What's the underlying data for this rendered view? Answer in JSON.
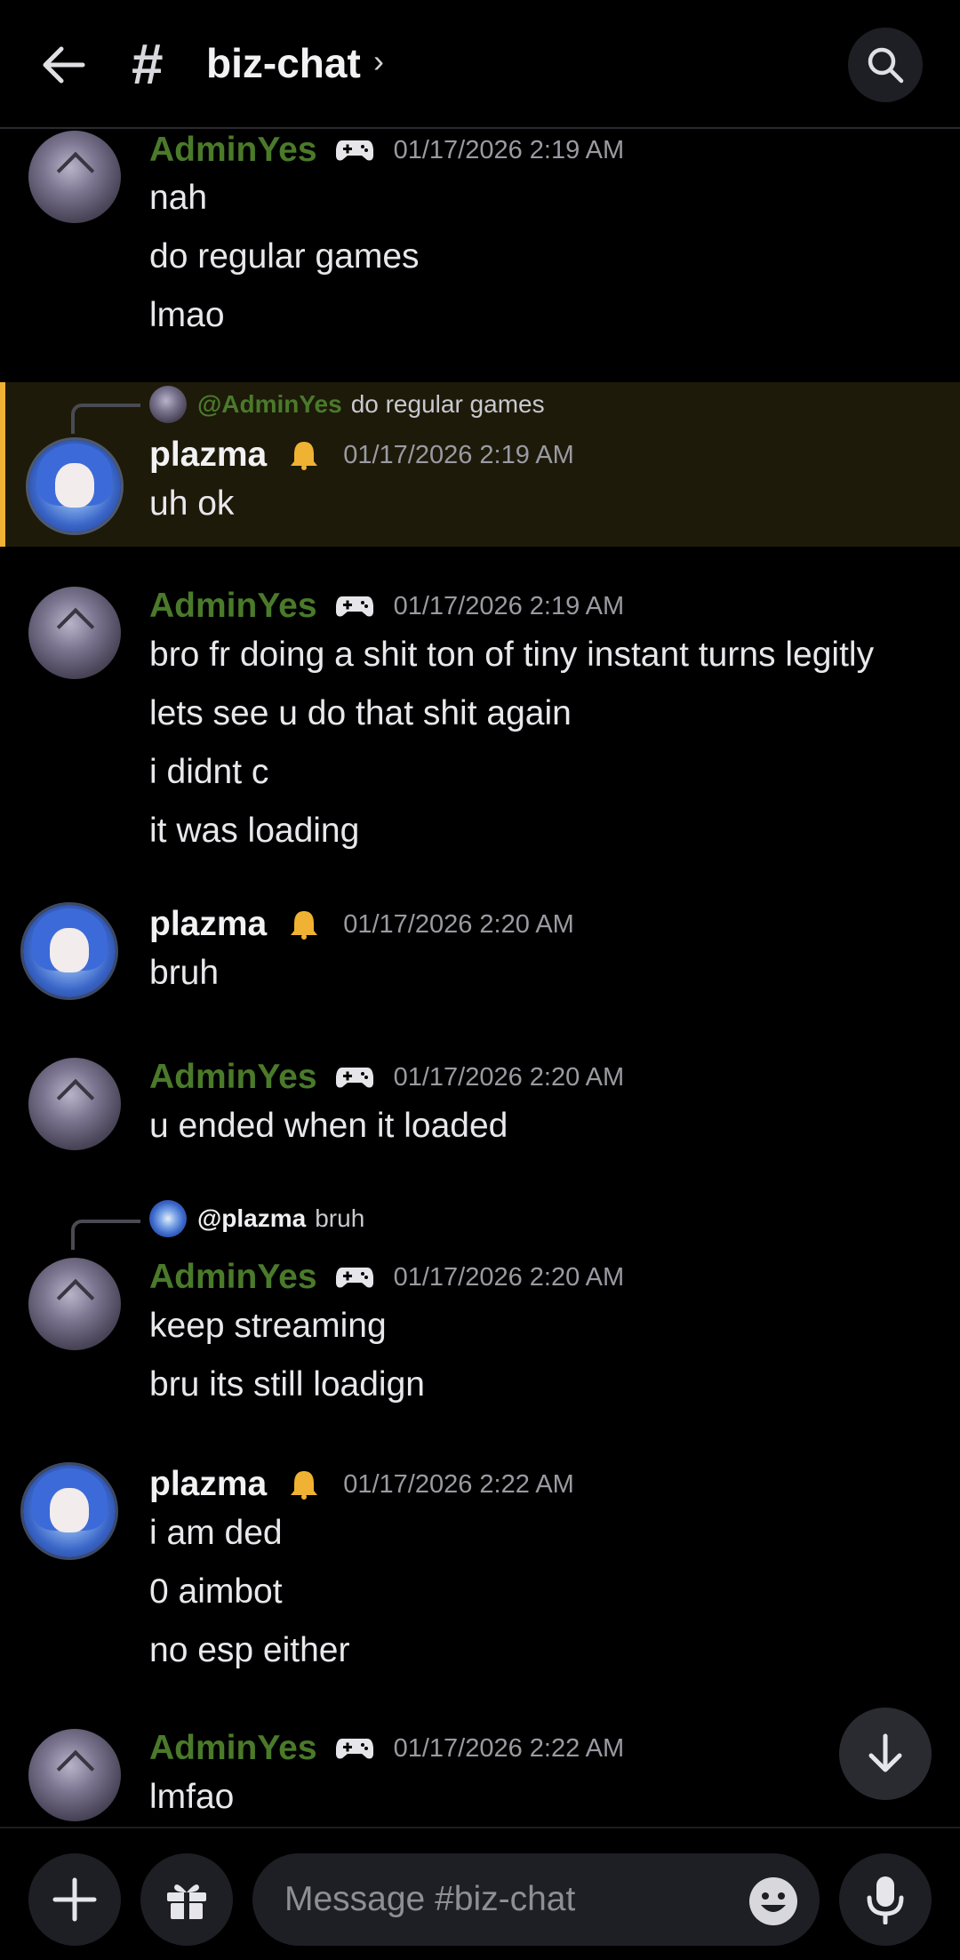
{
  "header": {
    "hash": "#",
    "channel": "biz-chat",
    "chevron": "›"
  },
  "messages": [
    {
      "author": "AdminYes",
      "time": "01/17/2026 2:19 AM",
      "lines": [
        "nah",
        "do regular games",
        "lmao"
      ]
    },
    {
      "author": "plazma",
      "time": "01/17/2026 2:19 AM",
      "highlighted": true,
      "reply": {
        "author": "@AdminYes",
        "text": "do regular games"
      },
      "lines": [
        "uh ok"
      ]
    },
    {
      "author": "AdminYes",
      "time": "01/17/2026 2:19 AM",
      "lines": [
        "bro fr doing a shit ton of tiny instant turns legitly",
        "lets see u do that shit again",
        "i didnt c",
        "it was loading"
      ]
    },
    {
      "author": "plazma",
      "time": "01/17/2026 2:20 AM",
      "lines": [
        "bruh"
      ]
    },
    {
      "author": "AdminYes",
      "time": "01/17/2026 2:20 AM",
      "lines": [
        "u ended when it loaded"
      ]
    },
    {
      "author": "AdminYes",
      "time": "01/17/2026 2:20 AM",
      "reply": {
        "author": "@plazma",
        "text": "bruh"
      },
      "lines": [
        "keep streaming",
        "bru its still loadign"
      ]
    },
    {
      "author": "plazma",
      "time": "01/17/2026 2:22 AM",
      "lines": [
        "i am ded",
        "0 aimbot",
        "no esp either"
      ]
    },
    {
      "author": "AdminYes",
      "time": "01/17/2026 2:22 AM",
      "lines": [
        "lmfao"
      ]
    }
  ],
  "composer": {
    "placeholder": "Message #biz-chat"
  },
  "icons": {
    "back": "arrow-left-icon",
    "search": "search-icon",
    "admin_badge": "gamepad-icon",
    "plazma_badge": "bell-badge-icon",
    "scroll": "arrow-down-icon",
    "plus": "plus-icon",
    "gift": "gift-icon",
    "emoji": "emoji-icon",
    "mic": "microphone-icon"
  },
  "colors": {
    "admin_name": "#4a7a2a",
    "highlight_bg": "#1d1a0a",
    "highlight_bar": "#f0b232"
  }
}
